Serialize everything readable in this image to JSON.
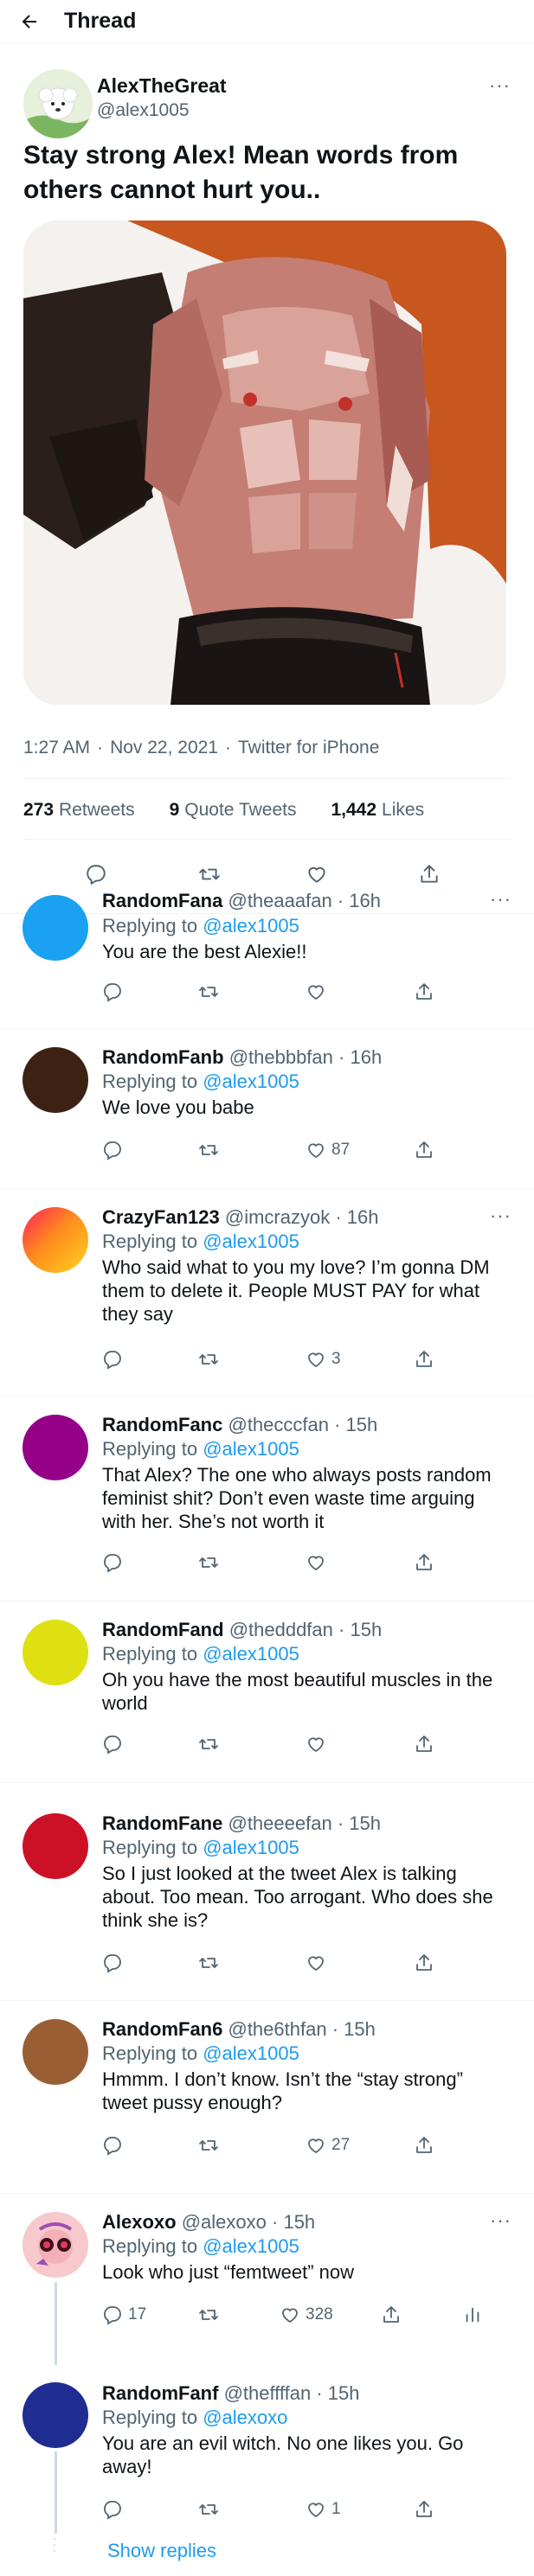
{
  "header": {
    "title": "Thread",
    "back_icon": "back-arrow-icon"
  },
  "main_tweet": {
    "name": "AlexTheGreat",
    "handle": "@alex1005",
    "text": "Stay strong Alex! Mean words from others cannot hurt you..",
    "time": "1:27 AM",
    "date": "Nov 22, 2021",
    "source": "Twitter for iPhone",
    "retweets_count": "273",
    "retweets_label": "Retweets",
    "quote_count": "9",
    "quote_label": "Quote Tweets",
    "likes_count": "1,442",
    "likes_label": "Likes",
    "more": "···"
  },
  "replies": [
    {
      "name": "RandomFana",
      "handle": "@theaaafan",
      "time": "16h",
      "replying_prefix": "Replying to",
      "replying_to": "@alex1005",
      "text": "You are the best Alexie!!",
      "likes": "",
      "avatar_color": "#1aa1f2"
    },
    {
      "name": "RandomFanb",
      "handle": "@thebbbfan",
      "time": "16h",
      "replying_prefix": "Replying to",
      "replying_to": "@alex1005",
      "text": "We love you babe",
      "likes": "87",
      "avatar_color": "#3d2214"
    },
    {
      "name": "CrazyFan123",
      "handle": "@imcrazyok",
      "time": "16h",
      "replying_prefix": "Replying to",
      "replying_to": "@alex1005",
      "text": "Who said what to you my love? I’m gonna DM them to delete it. People MUST PAY for what they say",
      "likes": "3",
      "avatar_color": "#ff9a1c"
    },
    {
      "name": "RandomFanc",
      "handle": "@thecccfan",
      "time": "15h",
      "replying_prefix": "Replying to",
      "replying_to": "@alex1005",
      "text": "That Alex? The one who always posts random feminist shit? Don’t even waste time arguing with her. She’s not worth it",
      "likes": "",
      "avatar_color": "#950089"
    },
    {
      "name": "RandomFand",
      "handle": "@thedddfan",
      "time": "15h",
      "replying_prefix": "Replying to",
      "replying_to": "@alex1005",
      "text": "Oh you have the most beautiful muscles in the world",
      "likes": "",
      "avatar_color": "#dfe012"
    },
    {
      "name": "RandomFane",
      "handle": "@theeeefan",
      "time": "15h",
      "replying_prefix": "Replying to",
      "replying_to": "@alex1005",
      "text": "So I just looked at the tweet Alex is talking about. Too mean. Too arrogant. Who does she think she is?",
      "likes": "",
      "avatar_color": "#cc1127"
    },
    {
      "name": "RandomFan6",
      "handle": "@the6thfan",
      "time": "15h",
      "replying_prefix": "Replying to",
      "replying_to": "@alex1005",
      "text": "Hmmm. I don’t know. Isn’t the “stay strong” tweet pussy enough?",
      "likes": "27",
      "avatar_color": "#9a5e35"
    },
    {
      "name": "Alexoxo",
      "handle": "@alexoxo",
      "time": "15h",
      "replying_prefix": "Replying to",
      "replying_to": "@alex1005",
      "text": "Look who just “femtweet” now",
      "likes": "328",
      "comments": "17",
      "avatar_color": "#f6c9cc"
    },
    {
      "name": "RandomFanf",
      "handle": "@theffffan",
      "time": "15h",
      "replying_prefix": "Replying to",
      "replying_to": "@alexoxo",
      "text": "You are an evil witch. No one likes you. Go away!",
      "likes": "1",
      "avatar_color": "#1f2c92"
    }
  ],
  "show_replies": "Show replies",
  "colors": {
    "accent": "#1d9bf0",
    "secondary_text": "#536471",
    "divider": "#eff3f4"
  },
  "icons": [
    "back-arrow-icon",
    "reply-icon",
    "retweet-icon",
    "like-icon",
    "share-icon",
    "analytics-icon",
    "more-icon"
  ]
}
